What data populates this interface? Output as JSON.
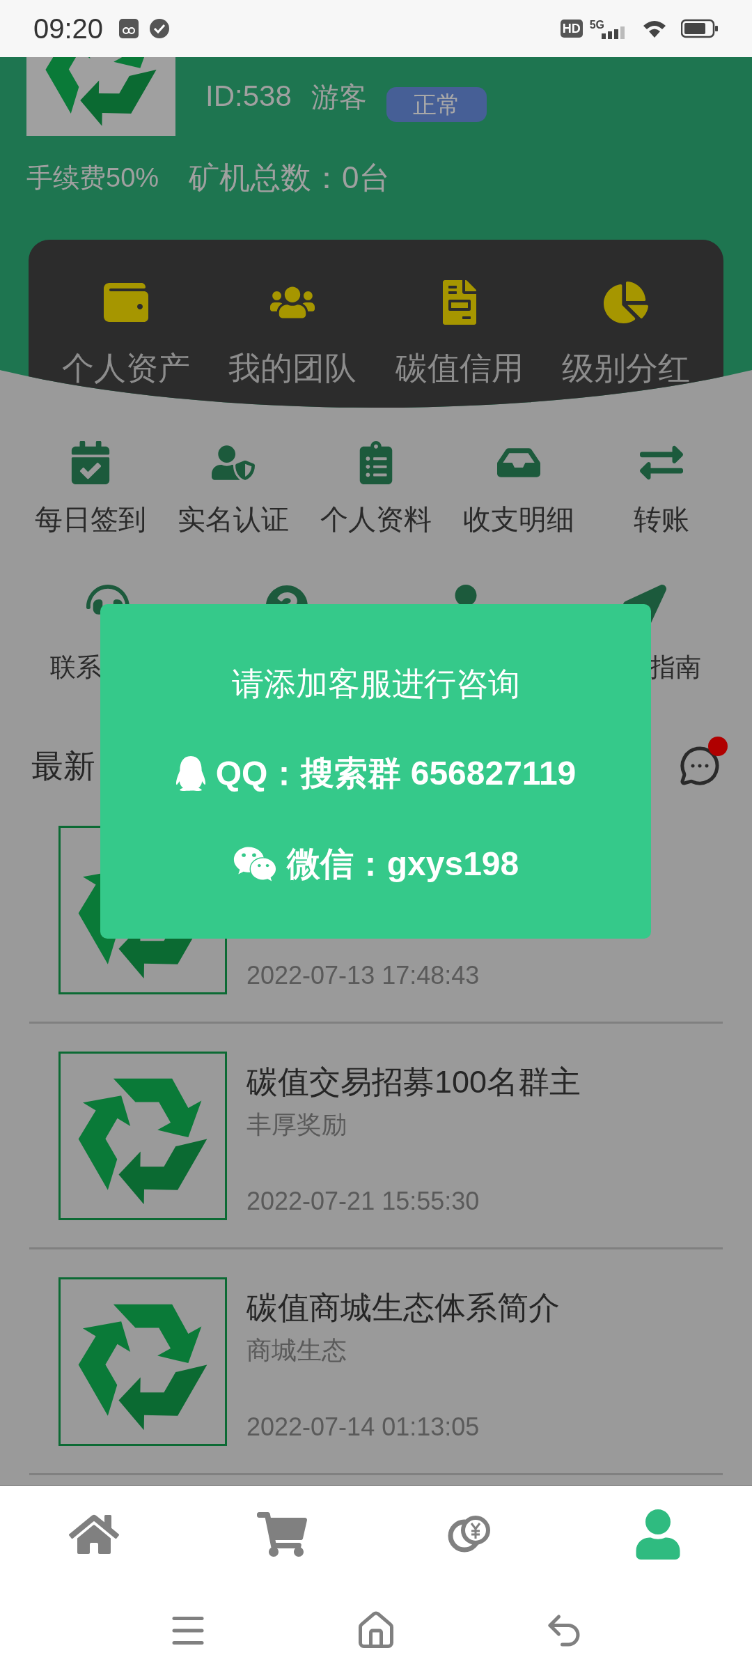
{
  "status_bar": {
    "time": "09:20",
    "network_labels": [
      "HD",
      "5G"
    ]
  },
  "profile": {
    "id": "ID:538",
    "role": "游客",
    "status": "正常",
    "fee": "手续费50%",
    "miners": "矿机总数：0台"
  },
  "quick_menu": [
    {
      "label": "个人资产"
    },
    {
      "label": "我的团队"
    },
    {
      "label": "碳值信用"
    },
    {
      "label": "级别分红"
    }
  ],
  "menu": [
    {
      "label": "每日签到"
    },
    {
      "label": "实名认证"
    },
    {
      "label": "个人资料"
    },
    {
      "label": "收支明细"
    },
    {
      "label": "转账"
    }
  ],
  "menu_row_2": {
    "first_label": "联系",
    "last_label": "指南"
  },
  "news": {
    "heading": "最新",
    "unread": true,
    "items": [
      {
        "date": "2022-07-13 17:48:43"
      },
      {
        "title": "碳值交易招募100名群主",
        "subtitle": "丰厚奖励",
        "date": "2022-07-21 15:55:30"
      },
      {
        "title": "碳值商城生态体系简介",
        "subtitle": "商城生态",
        "date": "2022-07-14 01:13:05"
      }
    ]
  },
  "dialog": {
    "title": "请添加客服进行咨询",
    "qq": "QQ：搜索群 656827119",
    "wechat": "微信：gxys198"
  },
  "bottom_nav": [
    {
      "selected": false
    },
    {
      "selected": false
    },
    {
      "selected": false
    },
    {
      "selected": true
    }
  ]
}
